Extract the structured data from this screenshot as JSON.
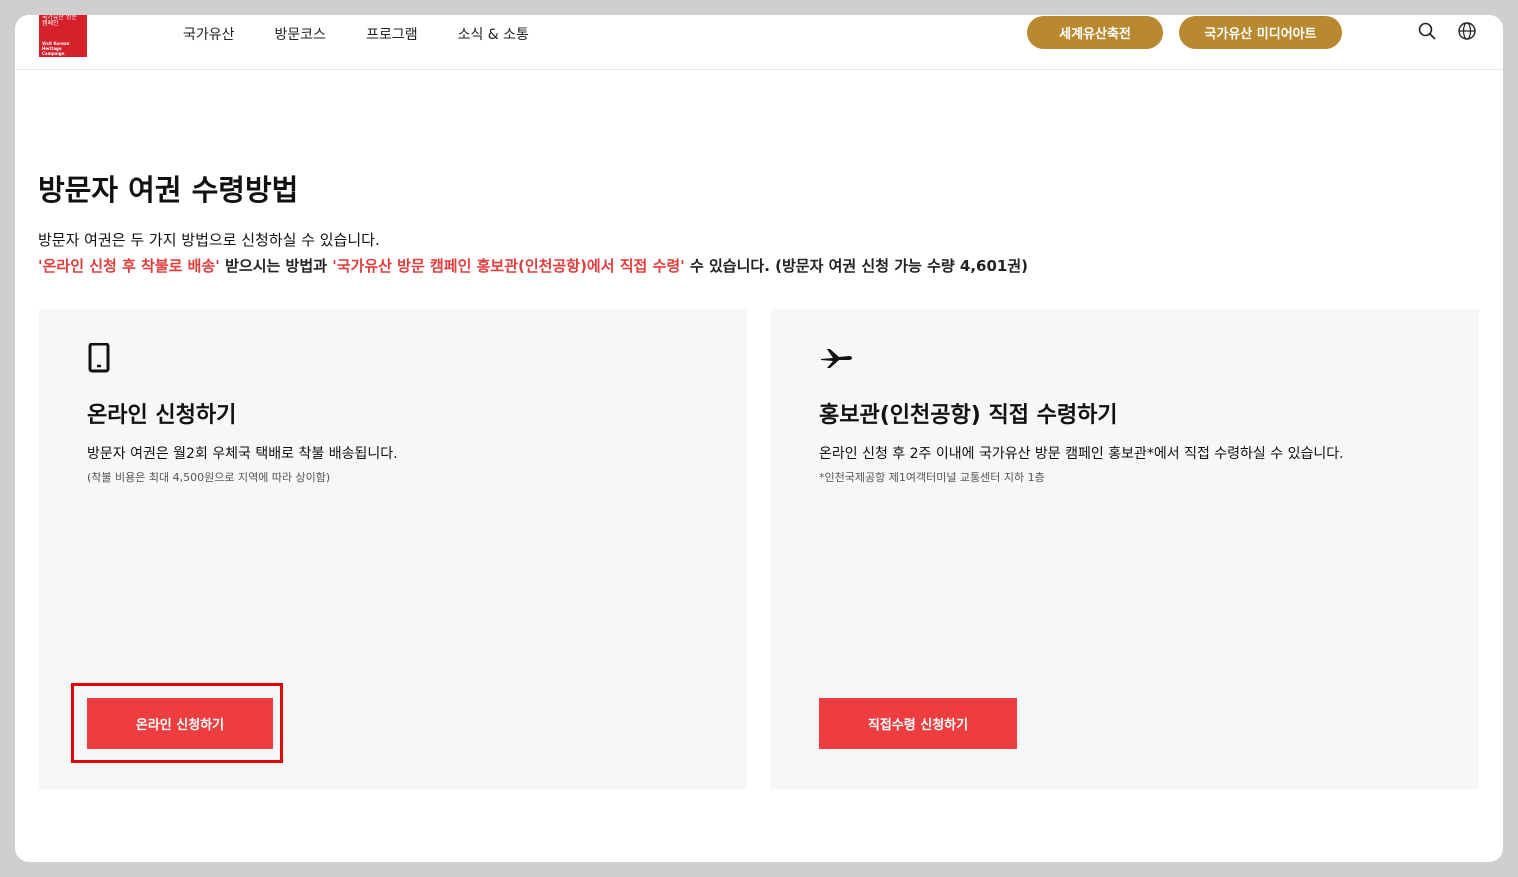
{
  "header": {
    "logo": {
      "line1": "국가유산 방문 캠페인",
      "line2": "Visit Korean Heritage Campaign"
    },
    "nav": [
      "국가유산",
      "방문코스",
      "프로그램",
      "소식 & 소통"
    ],
    "pill_buttons": [
      "세계유산축전",
      "국가유산 미디어아트"
    ],
    "icons": [
      "search-icon",
      "globe-icon"
    ],
    "accent_color": "#b8892f"
  },
  "main": {
    "title": "방문자 여권 수령방법",
    "intro_line1": "방문자 여권은 두 가지 방법으로 신청하실 수 있습니다.",
    "intro_line2": {
      "highlight1": "'온라인 신청 후 착불로 배송'",
      "text1": " 받으시는 방법과 ",
      "highlight2": "'국가유산 방문 캠페인 홍보관(인천공항)에서 직접 수령'",
      "text2": " 수 있습니다. (방문자 여권 신청 가능 수량 4,601권)"
    },
    "highlight_color": "#e23d3d"
  },
  "cards": [
    {
      "icon": "smartphone-icon",
      "title": "온라인 신청하기",
      "description": "방문자 여권은 월2회 우체국 택배로 착불 배송됩니다.",
      "note": "(착불 비용은 최대 4,500원으로 지역에 따라 상이함)",
      "button": "온라인 신청하기"
    },
    {
      "icon": "airplane-icon",
      "title": "홍보관(인천공항) 직접 수령하기",
      "description": "온라인 신청 후 2주 이내에 국가유산 방문 캠페인 홍보관*에서 직접 수령하실 수 있습니다.",
      "note": "*인천국제공항 제1여객터미널 교통센터 지하 1층",
      "button": "직접수령 신청하기"
    }
  ],
  "button_color": "#ee3d3f"
}
